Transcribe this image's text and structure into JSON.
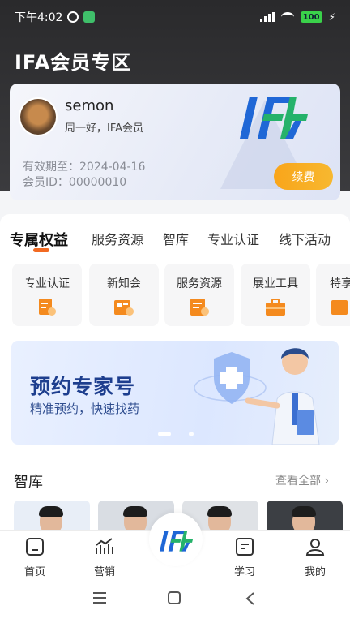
{
  "status_bar": {
    "time": "下午4:02",
    "battery": "100"
  },
  "header": {
    "title": "IFA会员专区"
  },
  "member_card": {
    "username": "semon",
    "greeting": "周一好，IFA会员",
    "valid_until": "有效期至：2024-04-16",
    "member_id": "会员ID：00000010",
    "renew_label": "续费"
  },
  "tabs": [
    {
      "label": "专属权益",
      "active": true
    },
    {
      "label": "服务资源"
    },
    {
      "label": "智库"
    },
    {
      "label": "专业认证"
    },
    {
      "label": "线下活动"
    }
  ],
  "shortcuts": [
    {
      "label": "专业认证",
      "icon": "certificate-icon"
    },
    {
      "label": "新知会",
      "icon": "news-icon"
    },
    {
      "label": "服务资源",
      "icon": "document-icon"
    },
    {
      "label": "展业工具",
      "icon": "toolbox-icon"
    },
    {
      "label": "特享",
      "icon": "special-icon"
    }
  ],
  "banner": {
    "title": "预约专家号",
    "subtitle": "精准预约，快速找药"
  },
  "think_tank": {
    "title": "智库",
    "see_all": "查看全部 ›"
  },
  "bottom_nav": [
    {
      "label": "首页",
      "icon": "home-icon"
    },
    {
      "label": "营销",
      "icon": "chart-icon"
    },
    {
      "label": "",
      "icon": "ifa-logo-icon"
    },
    {
      "label": "学习",
      "icon": "book-icon"
    },
    {
      "label": "我的",
      "icon": "profile-icon"
    }
  ],
  "colors": {
    "accent_orange": "#f26a22",
    "renew_gradient_start": "#f9a51a",
    "banner_title": "#1d3e8e",
    "logo_blue": "#1f67d6",
    "logo_green": "#25b26a"
  }
}
